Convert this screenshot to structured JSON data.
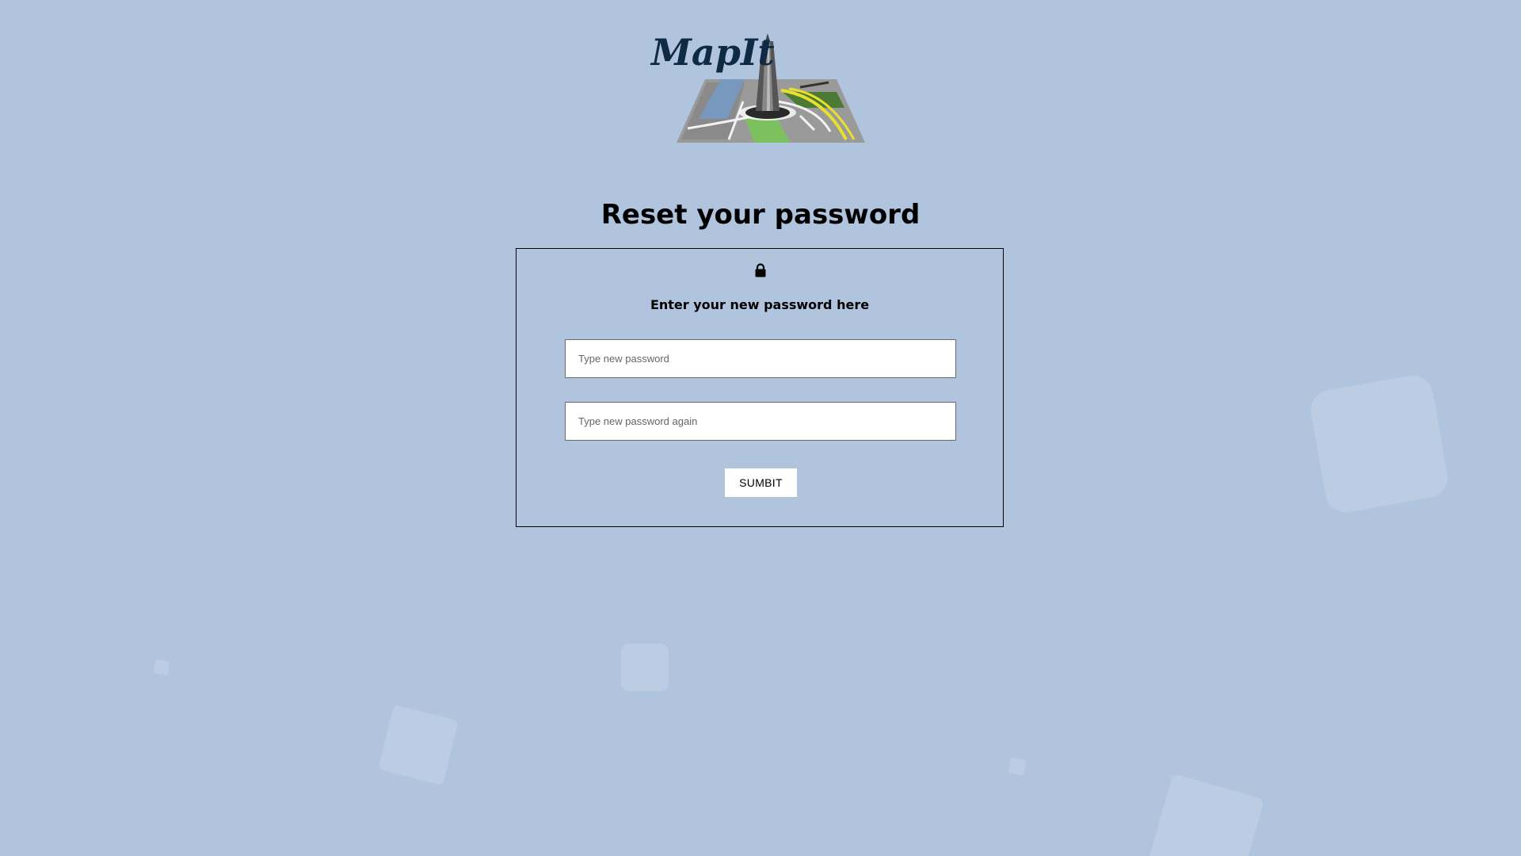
{
  "logo": {
    "text": "MapIt"
  },
  "page": {
    "title": "Reset your password"
  },
  "card": {
    "icon": "lock-icon",
    "subtitle": "Enter your new password here",
    "new_password_placeholder": "Type new password",
    "new_password_value": "",
    "confirm_password_placeholder": "Type new password again",
    "confirm_password_value": "",
    "submit_label": "SUMBIT"
  },
  "colors": {
    "background": "#b0c4de",
    "logo_text": "#0f2a45"
  }
}
